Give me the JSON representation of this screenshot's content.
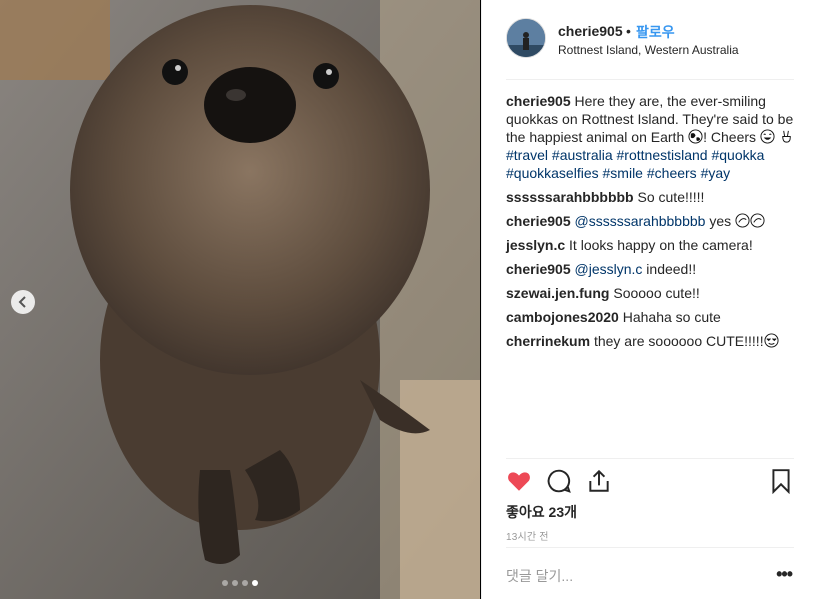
{
  "post": {
    "username": "cherie905",
    "separator": "•",
    "follow_label": "팔로우",
    "location": "Rottnest Island, Western Australia"
  },
  "caption": {
    "user": "cherie905",
    "text1": "Here they are, the ever-smiling quokkas on Rottnest Island. They're said to be the happiest animal on Earth ",
    "text2": "! Cheers ",
    "tags": [
      "#travel",
      "#australia",
      "#rottnestisland",
      "#quokka",
      "#quokkaselfies",
      "#smile",
      "#cheers",
      "#yay"
    ]
  },
  "comments": [
    {
      "user": "ssssssarahbbbbbb",
      "text": "So cute!!!!!"
    },
    {
      "user": "cherie905",
      "mention": "@ssssssarahbbbbbb",
      "text": "yes"
    },
    {
      "user": "jesslyn.c",
      "text": "It looks happy on the camera!"
    },
    {
      "user": "cherie905",
      "mention": "@jesslyn.c",
      "text": "indeed!!"
    },
    {
      "user": "szewai.jen.fung",
      "text": "Sooooo cute!!"
    },
    {
      "user": "cambojones2020",
      "text": "Hahaha so cute"
    },
    {
      "user": "cherrinekum",
      "text": "they are soooooo CUTE!!!!!"
    }
  ],
  "likes": "좋아요 23개",
  "time_ago": "13시간 전",
  "add_comment_placeholder": "댓글 달기...",
  "more_label": "•••",
  "carousel": {
    "total": 4,
    "active_index": 3
  },
  "colors": {
    "like_red": "#ed4956",
    "link_blue": "#3897f0",
    "hashtag": "#003569"
  },
  "icons": [
    "heart-icon",
    "comment-icon",
    "share-icon",
    "bookmark-icon",
    "chevron-left-icon"
  ]
}
